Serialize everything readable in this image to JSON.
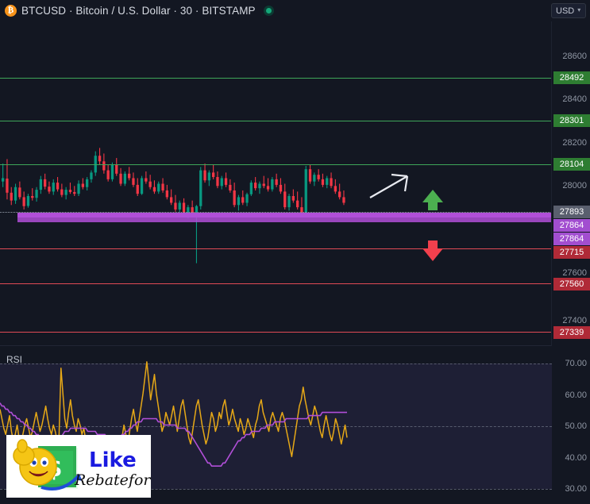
{
  "header": {
    "icon": "bitcoin-icon",
    "symbol_title": "BTCUSD · Bitcoin / U.S. Dollar · 30 · BITSTAMP",
    "market_status": "market-open-dot",
    "currency_selector": "USD",
    "chevron": "⌄"
  },
  "price_axis": {
    "ticks": [
      "28600",
      "28400",
      "28200",
      "28000",
      "27600",
      "27400"
    ],
    "tags": [
      {
        "value": "28492",
        "kind": "resistance",
        "color": "#2e7d32"
      },
      {
        "value": "28301",
        "kind": "resistance",
        "color": "#2e7d32"
      },
      {
        "value": "28104",
        "kind": "resistance",
        "color": "#2e7d32"
      },
      {
        "value": "27893",
        "kind": "last-price",
        "color": "#5a5f6e"
      },
      {
        "value": "27864",
        "kind": "zone-upper",
        "color": "#a24ed0"
      },
      {
        "value": "27864",
        "kind": "zone-lower",
        "color": "#a24ed0"
      },
      {
        "value": "27715",
        "kind": "support",
        "color": "#b02a37"
      },
      {
        "value": "27560",
        "kind": "support",
        "color": "#b02a37"
      },
      {
        "value": "27339",
        "kind": "support",
        "color": "#b02a37"
      }
    ]
  },
  "indicator": {
    "title": "RSI",
    "ticks": [
      "70.00",
      "60.00",
      "50.00",
      "40.00",
      "30.00"
    ],
    "line_color": "#e6a817",
    "ma_color": "#b14fd8",
    "band_color": "#1e1f35"
  },
  "annotations": {
    "trend_arrow": "white-diagonal-up-arrow",
    "bullish_arrow": "green-up-arrow",
    "bearish_arrow": "red-down-arrow"
  },
  "watermark": {
    "brand_primary": "Like",
    "brand_secondary": "Rebateforex",
    "icon": "smiley-thumbs-up-money-icon"
  },
  "colors": {
    "background": "#131722",
    "candle_up": "#089981",
    "candle_down": "#f23645",
    "resistance": "#3ea659",
    "support": "#e04a55",
    "zone": "#b14fd8"
  },
  "chart_data": {
    "type": "candlestick",
    "title": "BTCUSD · Bitcoin / U.S. Dollar · 30 · BITSTAMP",
    "xlabel": "",
    "ylabel": "USD",
    "ylim": [
      27250,
      28700
    ],
    "yticks": [
      27400,
      27600,
      28000,
      28200,
      28400,
      28600
    ],
    "grid": false,
    "last_price": 27893,
    "levels": [
      {
        "price": 28492,
        "type": "resistance",
        "color": "#3ea659"
      },
      {
        "price": 28301,
        "type": "resistance",
        "color": "#3ea659"
      },
      {
        "price": 28104,
        "type": "resistance",
        "color": "#3ea659"
      },
      {
        "price": 27893,
        "type": "last-price-dotted",
        "color": "#9aa0ad"
      },
      {
        "price": 27864,
        "type": "supply-zone",
        "color": "#b14fd8"
      },
      {
        "price": 27715,
        "type": "support",
        "color": "#e04a55"
      },
      {
        "price": 27560,
        "type": "support",
        "color": "#e04a55"
      },
      {
        "price": 27339,
        "type": "support",
        "color": "#e04a55"
      }
    ],
    "candles": [
      [
        27985,
        28065,
        27960,
        28000
      ],
      [
        27998,
        28085,
        27905,
        27935
      ],
      [
        27935,
        27960,
        27880,
        27900
      ],
      [
        27900,
        27975,
        27885,
        27960
      ],
      [
        27958,
        27985,
        27905,
        27915
      ],
      [
        27915,
        27940,
        27860,
        27875
      ],
      [
        27876,
        27930,
        27868,
        27920
      ],
      [
        27920,
        27955,
        27900,
        27912
      ],
      [
        27912,
        27960,
        27895,
        27948
      ],
      [
        27948,
        28010,
        27930,
        27995
      ],
      [
        27995,
        28020,
        27950,
        27962
      ],
      [
        27962,
        27985,
        27930,
        27940
      ],
      [
        27940,
        27995,
        27925,
        27980
      ],
      [
        27980,
        28005,
        27940,
        27950
      ],
      [
        27950,
        27975,
        27915,
        27925
      ],
      [
        27925,
        27960,
        27905,
        27948
      ],
      [
        27948,
        27980,
        27930,
        27938
      ],
      [
        27938,
        27965,
        27920,
        27930
      ],
      [
        27930,
        27990,
        27920,
        27975
      ],
      [
        27975,
        28000,
        27950,
        27960
      ],
      [
        27960,
        28005,
        27945,
        27995
      ],
      [
        27995,
        28035,
        27980,
        28025
      ],
      [
        28025,
        28120,
        28010,
        28100
      ],
      [
        28100,
        28135,
        28060,
        28075
      ],
      [
        28075,
        28110,
        28020,
        28035
      ],
      [
        28035,
        28060,
        27985,
        27995
      ],
      [
        27995,
        28070,
        27985,
        28060
      ],
      [
        28060,
        28090,
        28010,
        28020
      ],
      [
        28020,
        28045,
        27965,
        27975
      ],
      [
        27975,
        28030,
        27965,
        28020
      ],
      [
        28020,
        28050,
        27990,
        28000
      ],
      [
        28000,
        28025,
        27960,
        27970
      ],
      [
        27970,
        28000,
        27920,
        27930
      ],
      [
        27930,
        28010,
        27925,
        28000
      ],
      [
        28000,
        28030,
        27975,
        27985
      ],
      [
        27985,
        28015,
        27950,
        27960
      ],
      [
        27960,
        27990,
        27930,
        27940
      ],
      [
        27940,
        27985,
        27930,
        27975
      ],
      [
        27975,
        28000,
        27935,
        27945
      ],
      [
        27945,
        27970,
        27905,
        27915
      ],
      [
        27915,
        27950,
        27880,
        27890
      ],
      [
        27890,
        27925,
        27850,
        27860
      ],
      [
        27860,
        27900,
        27845,
        27890
      ],
      [
        27890,
        27910,
        27835,
        27845
      ],
      [
        27845,
        27880,
        27820,
        27870
      ],
      [
        27870,
        27900,
        27830,
        27840
      ],
      [
        27840,
        27880,
        27620,
        27875
      ],
      [
        27875,
        28050,
        27860,
        28035
      ],
      [
        28035,
        28065,
        27980,
        27990
      ],
      [
        27990,
        28035,
        27965,
        28025
      ],
      [
        28025,
        28060,
        27995,
        28005
      ],
      [
        28005,
        28030,
        27955,
        27965
      ],
      [
        27965,
        28010,
        27950,
        28000
      ],
      [
        28000,
        28025,
        27960,
        27970
      ],
      [
        27970,
        27995,
        27935,
        27945
      ],
      [
        27945,
        27980,
        27870,
        27880
      ],
      [
        27880,
        27925,
        27855,
        27915
      ],
      [
        27915,
        27945,
        27880,
        27890
      ],
      [
        27890,
        27935,
        27875,
        27928
      ],
      [
        27928,
        27990,
        27920,
        27980
      ],
      [
        27980,
        28005,
        27945,
        27955
      ],
      [
        27955,
        27985,
        27930,
        27975
      ],
      [
        27975,
        28010,
        27955,
        27965
      ],
      [
        27965,
        28000,
        27940,
        27950
      ],
      [
        27950,
        28005,
        27940,
        27995
      ],
      [
        27995,
        28020,
        27960,
        27970
      ],
      [
        27970,
        28000,
        27930,
        27940
      ],
      [
        27940,
        27975,
        27860,
        27870
      ],
      [
        27870,
        27930,
        27855,
        27920
      ],
      [
        27920,
        27950,
        27890,
        27900
      ],
      [
        27900,
        27940,
        27860,
        27870
      ],
      [
        27870,
        27915,
        27835,
        27845
      ],
      [
        27845,
        28055,
        27840,
        28040
      ],
      [
        28040,
        28060,
        27975,
        27985
      ],
      [
        27985,
        28025,
        27965,
        28015
      ],
      [
        28015,
        28040,
        27985,
        27995
      ],
      [
        27995,
        28020,
        27960,
        27970
      ],
      [
        27970,
        28010,
        27955,
        28000
      ],
      [
        28000,
        28025,
        27955,
        27965
      ],
      [
        27965,
        27995,
        27930,
        27940
      ],
      [
        27940,
        27975,
        27905,
        27915
      ],
      [
        27915,
        27945,
        27880,
        27890
      ]
    ],
    "rsi": {
      "type": "line",
      "ylim": [
        25,
        75
      ],
      "yticks": [
        30,
        40,
        50,
        60,
        70
      ],
      "series": [
        {
          "name": "RSI",
          "color": "#e6a817",
          "values": [
            55,
            52,
            49,
            47,
            50,
            53,
            48,
            45,
            47,
            50,
            46,
            44,
            47,
            50,
            52,
            49,
            46,
            48,
            51,
            54,
            51,
            48,
            50,
            53,
            56,
            52,
            49,
            47,
            50,
            48,
            45,
            47,
            68,
            60,
            52,
            49,
            54,
            58,
            53,
            50,
            48,
            52,
            50,
            47,
            49,
            45,
            42,
            39,
            43,
            46,
            42,
            38,
            35,
            38,
            42,
            38,
            34,
            31,
            36,
            40,
            45,
            42,
            38,
            41,
            46,
            50,
            47,
            44,
            48,
            52,
            55,
            51,
            48,
            52,
            56,
            60,
            65,
            70,
            64,
            58,
            62,
            66,
            60,
            56,
            52,
            48,
            50,
            54,
            52,
            50,
            53,
            56,
            52,
            48,
            52,
            56,
            58,
            54,
            50,
            46,
            44,
            48,
            52,
            56,
            58,
            54,
            50,
            47,
            44,
            46,
            50,
            54,
            52,
            48,
            50,
            54,
            52,
            56,
            58,
            54,
            50,
            52,
            55,
            52,
            50,
            48,
            52,
            50,
            47,
            49,
            52,
            50,
            48,
            46,
            50,
            52,
            56,
            58,
            54,
            52,
            50,
            48,
            52,
            54,
            52,
            50,
            48,
            52,
            54,
            52,
            49,
            46,
            43,
            40,
            44,
            48,
            52,
            56,
            58,
            62,
            58,
            55,
            52,
            50,
            53,
            56,
            54,
            51,
            48,
            46,
            50,
            53,
            50,
            47,
            45,
            48,
            52,
            50,
            47,
            44,
            47,
            50,
            46
          ]
        },
        {
          "name": "RSI MA",
          "color": "#b14fd8",
          "values": [
            57,
            56,
            56,
            55,
            55,
            54,
            54,
            53,
            53,
            52,
            52,
            51,
            51,
            50,
            50,
            49,
            49,
            48,
            48,
            47,
            47,
            46,
            46,
            46,
            45,
            45,
            45,
            45,
            45,
            45,
            45,
            45,
            46,
            47,
            48,
            48,
            48,
            49,
            49,
            49,
            49,
            49,
            49,
            49,
            49,
            49,
            48,
            48,
            48,
            48,
            48,
            47,
            47,
            47,
            47,
            47,
            46,
            46,
            46,
            46,
            46,
            46,
            46,
            46,
            47,
            47,
            48,
            48,
            49,
            49,
            50,
            50,
            51,
            51,
            51,
            52,
            52,
            52,
            52,
            52,
            52,
            52,
            52,
            51,
            51,
            51,
            50,
            50,
            50,
            50,
            50,
            50,
            50,
            49,
            49,
            49,
            49,
            49,
            48,
            48,
            47,
            46,
            45,
            44,
            43,
            42,
            41,
            40,
            39,
            38,
            38,
            37,
            37,
            37,
            37,
            37,
            37,
            38,
            38,
            39,
            40,
            41,
            42,
            43,
            44,
            45,
            45,
            46,
            46,
            47,
            47,
            47,
            48,
            48,
            48,
            48,
            48,
            49,
            49,
            49,
            50,
            50,
            50,
            50,
            51,
            51,
            51,
            51,
            51,
            51,
            52,
            52,
            52,
            52,
            52,
            52,
            52,
            52,
            52,
            52,
            52,
            52,
            53,
            53,
            53,
            53,
            53,
            53,
            53,
            54,
            54,
            54,
            54,
            54,
            54,
            54,
            54,
            54,
            54,
            54,
            54,
            54,
            54
          ]
        }
      ]
    }
  }
}
